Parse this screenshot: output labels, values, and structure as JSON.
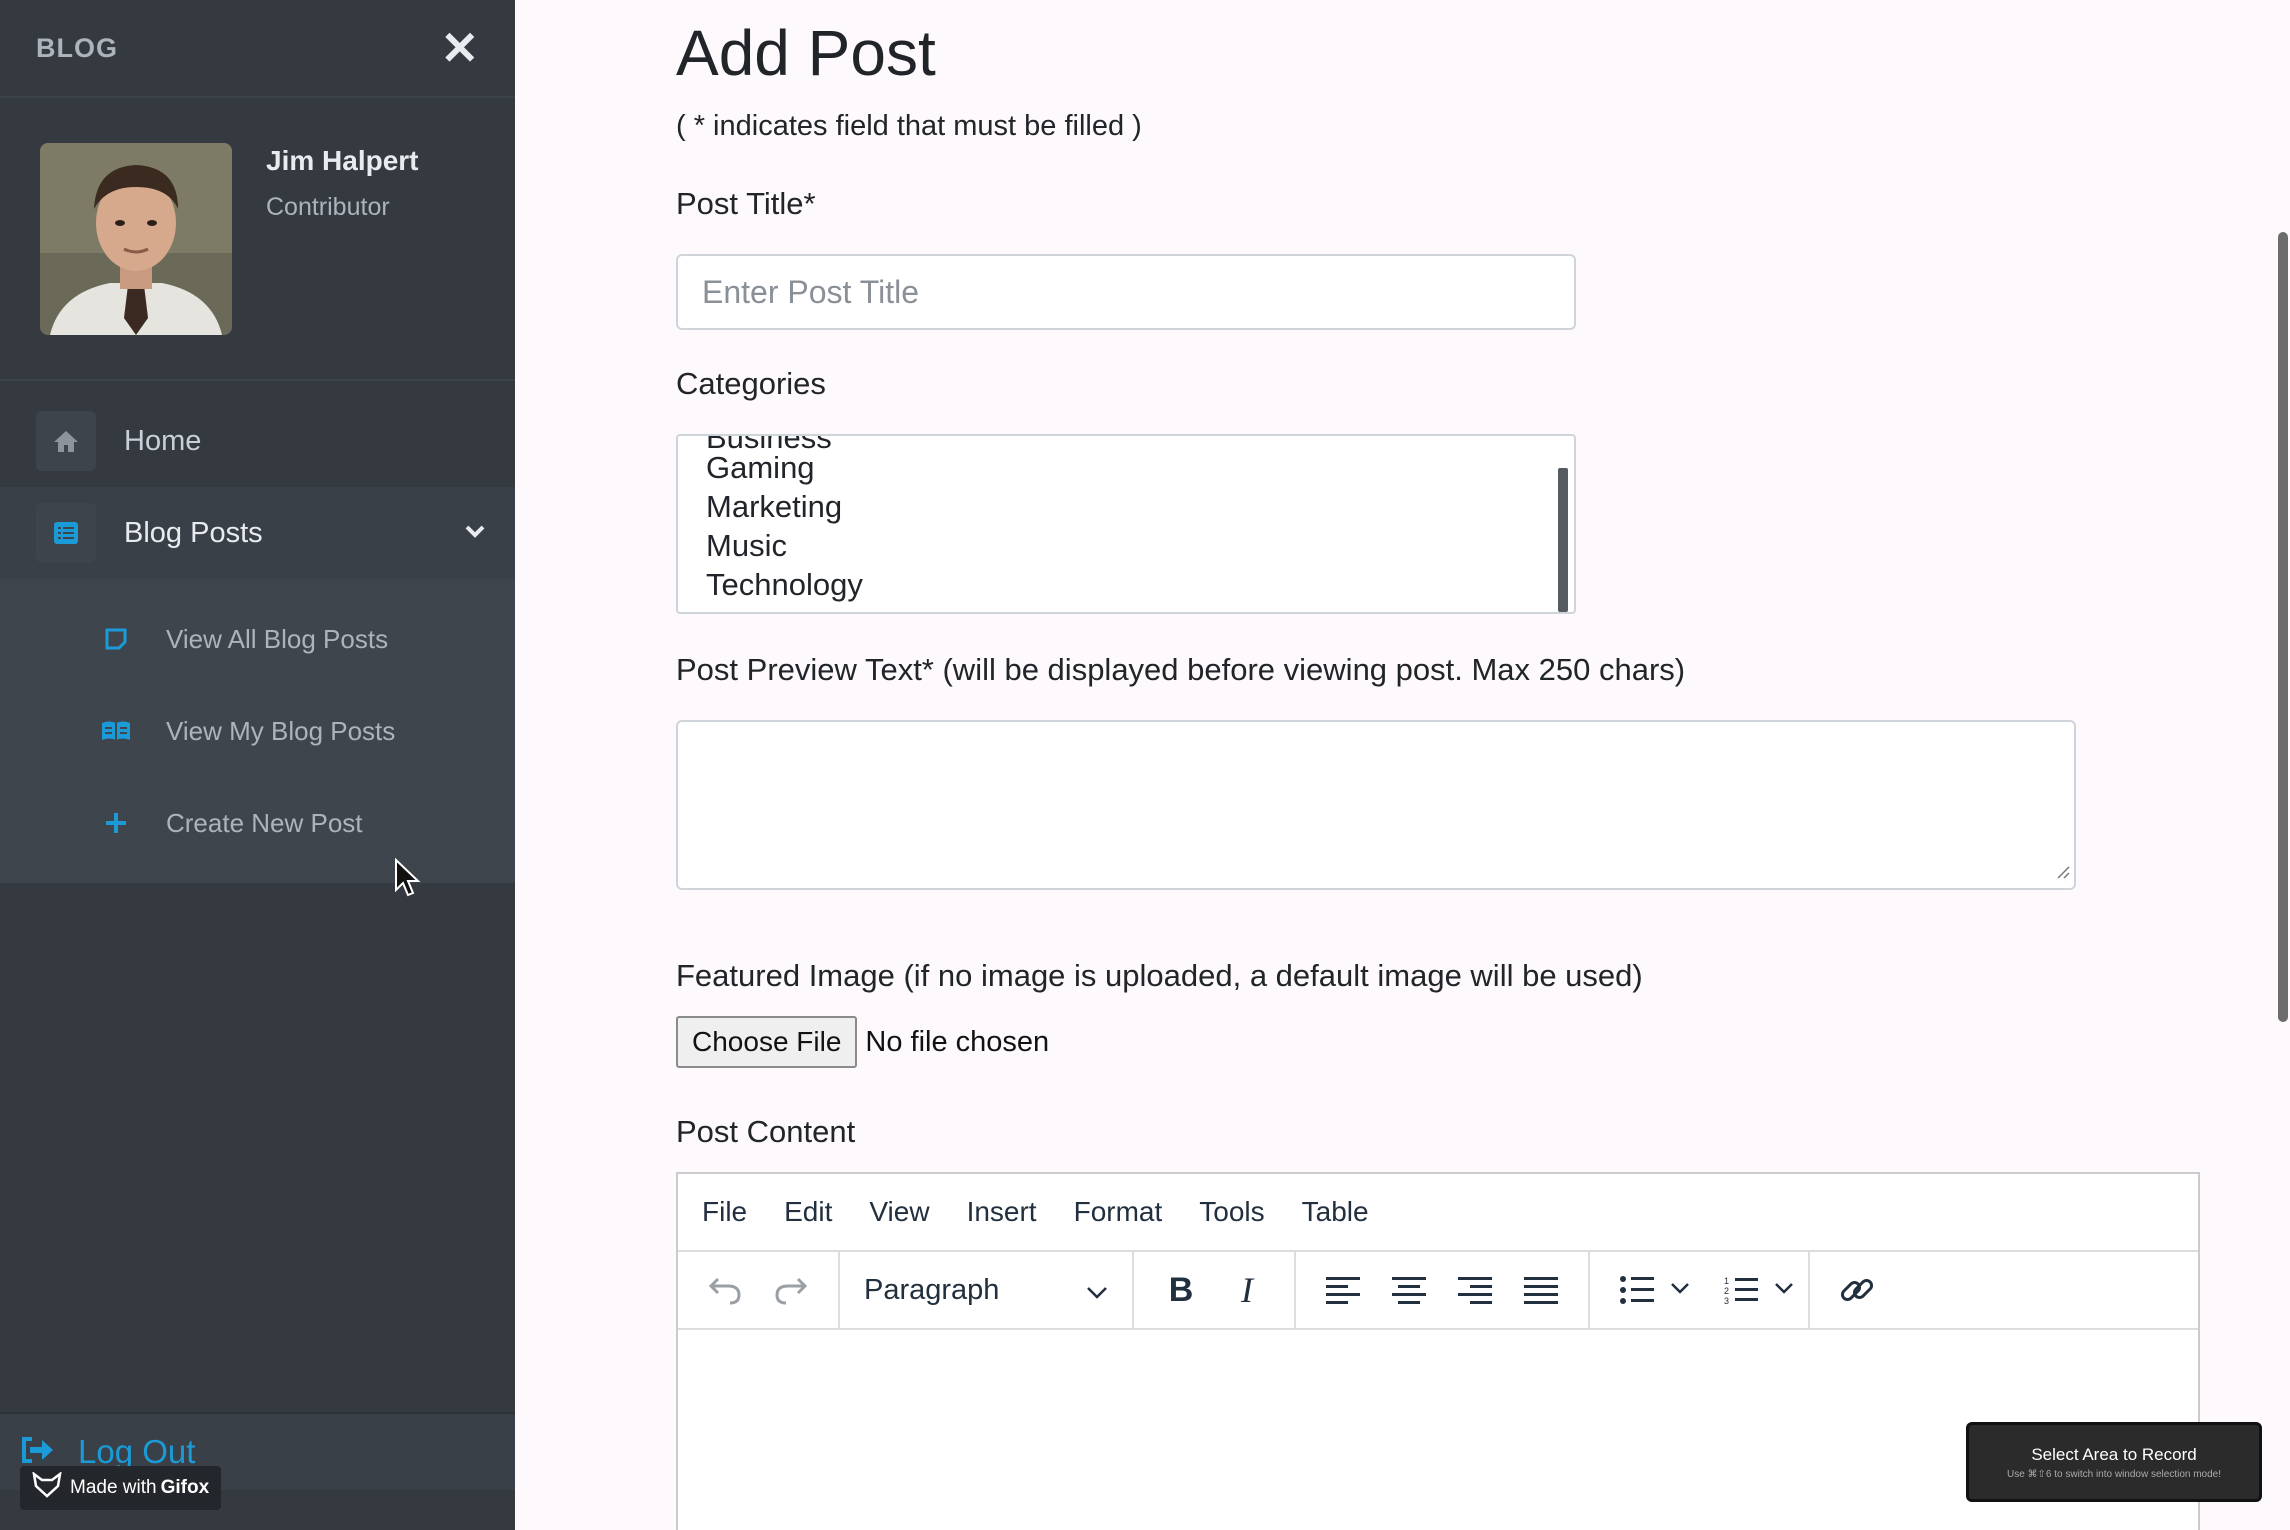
{
  "sidebar": {
    "brand": "BLOG",
    "close_icon": "close-icon",
    "user": {
      "name": "Jim Halpert",
      "role": "Contributor"
    },
    "nav": [
      {
        "label": "Home",
        "icon": "home-icon"
      },
      {
        "label": "Blog Posts",
        "icon": "list-icon"
      }
    ],
    "submenu": [
      {
        "label": "View All Blog Posts",
        "icon": "note-icon"
      },
      {
        "label": "View My Blog Posts",
        "icon": "book-icon"
      },
      {
        "label": "Create New Post",
        "icon": "plus-icon"
      }
    ],
    "logout_label": "Log Out",
    "watermark": {
      "prefix": "Made with",
      "brand": "Gifox"
    },
    "accent": "#1b9ad8"
  },
  "form": {
    "title": "Add Post",
    "hint": "( * indicates field that must be filled )",
    "post_title_label": "Post Title*",
    "post_title_placeholder": "Enter Post Title",
    "categories_label": "Categories",
    "categories": [
      "Business",
      "Gaming",
      "Marketing",
      "Music",
      "Technology"
    ],
    "preview_label": "Post Preview Text* (will be displayed before viewing post. Max 250 chars)",
    "image_label": "Featured Image (if no image is uploaded, a default image will be used)",
    "file_button": "Choose File",
    "file_status": "No file chosen",
    "content_label": "Post Content"
  },
  "editor": {
    "menus": [
      "File",
      "Edit",
      "View",
      "Insert",
      "Format",
      "Tools",
      "Table"
    ],
    "block_format": "Paragraph"
  },
  "recorder": {
    "title": "Select Area to Record",
    "subtitle": "Use ⌘⇧6 to switch into window selection mode!"
  }
}
